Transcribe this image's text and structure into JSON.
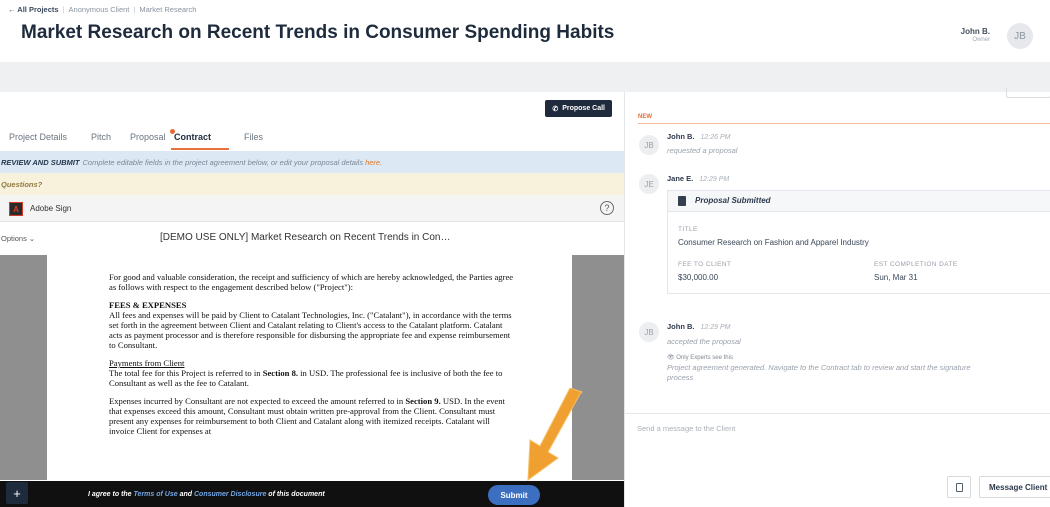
{
  "header": {
    "breadcrumb": {
      "back": "← All Projects",
      "client": "Anonymous Client",
      "category": "Market Research"
    },
    "title": "Market Research on Recent Trends in Consumer Spending Habits",
    "user": {
      "name": "John B.",
      "role": "Owner",
      "initials": "JB"
    }
  },
  "left": {
    "propose_call": "Propose Call",
    "tabs": [
      {
        "label": "Project Details"
      },
      {
        "label": "Pitch"
      },
      {
        "label": "Proposal"
      },
      {
        "label": "Contract"
      },
      {
        "label": "Files"
      }
    ],
    "active_tab": "Contract",
    "review": {
      "strong": "REVIEW AND SUBMIT",
      "text": "Complete editable fields in the project agreement below, or edit your proposal details",
      "link": "here."
    },
    "questions": "Questions?",
    "sign": {
      "label": "Adobe Sign",
      "logo": "A",
      "help": "?"
    },
    "options_label": "Options ⌄",
    "doc_title": "[DEMO USE ONLY] Market Research on Recent Trends in Con…",
    "document": {
      "para1": "For good and valuable consideration, the receipt and sufficiency of which are hereby acknowledged, the Parties agree as follows with respect to the engagement described below (\"Project\"):",
      "fees_heading": "FEES & EXPENSES",
      "fees_text": "All fees and expenses will be paid by Client to Catalant Technologies, Inc. (\"Catalant\"), in accordance with the terms set forth in the agreement between Client and Catalant relating to Client's access to the Catalant platform. Catalant acts as payment processor and is therefore responsible for disbursing the appropriate fee and expense reimbursement to Consultant.",
      "payments_heading": "Payments from Client",
      "payments_pre": "The total fee for this Project is referred to in",
      "payments_bold": "Section 8.",
      "payments_post": "in USD.  The professional fee is inclusive of both the fee to Consultant as well as the fee to Catalant.",
      "expenses_pre": "Expenses incurred by Consultant are not expected to exceed the amount referred to in",
      "expenses_bold": "Section 9.",
      "expenses_post": "USD. In the event that expenses exceed this amount, Consultant must obtain written pre-approval from the Client. Consultant must present any expenses for reimbursement to both Client and Catalant along with itemized receipts.  Catalant will invoice Client for expenses at"
    },
    "footer": {
      "plus": "+",
      "agree_pre": "I agree to the",
      "terms": "Terms of Use",
      "and": "and",
      "disclosure": "Consumer Disclosure",
      "agree_post": "of this document",
      "submit": "Submit"
    }
  },
  "right": {
    "new_label": "NEW",
    "messages": [
      {
        "initials": "JB",
        "name": "John B.",
        "time": "12:26 PM",
        "text": "requested a proposal"
      },
      {
        "initials": "JE",
        "name": "Jane E.",
        "time": "12:29 PM"
      },
      {
        "initials": "JB",
        "name": "John B.",
        "time": "12:29 PM",
        "text": "accepted the proposal"
      }
    ],
    "proposal_card": {
      "header": "Proposal Submitted",
      "title_label": "TITLE",
      "title_value": "Consumer Research on Fashion and Apparel Industry",
      "fee_label": "FEE TO CLIENT",
      "fee_value": "$30,000.00",
      "date_label": "EST COMPLETION DATE",
      "date_value": "Sun, Mar 31"
    },
    "experts_note": "👁 Only Experts see this",
    "system_line1": "Project agreement generated. Navigate to the Contract tab to review and start the signature",
    "system_line2": "process",
    "compose_placeholder": "Send a message to the Client",
    "message_client": "Message Client"
  },
  "colors": {
    "accent": "#e7723c",
    "submit": "#3c6fc0",
    "dark": "#1f2b3d",
    "arrow": "#f0a030"
  }
}
